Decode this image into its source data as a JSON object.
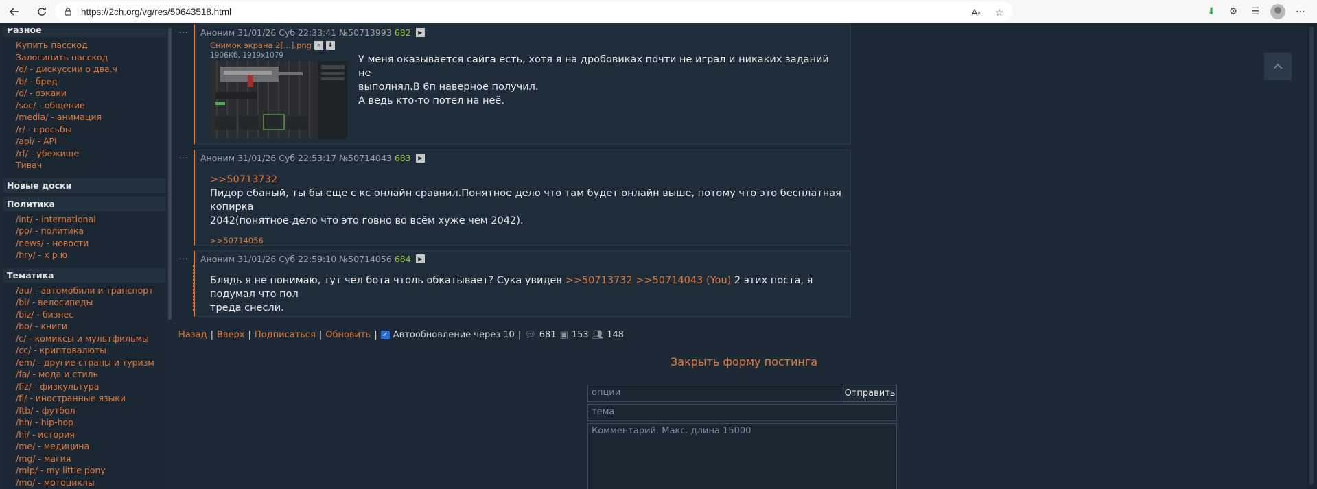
{
  "browser": {
    "url": "https://2ch.org/vg/res/50643518.html"
  },
  "sidebar": {
    "sections": [
      {
        "title": "Разное",
        "items": [
          "Купить пасскод",
          "Залогинить пасскод",
          "/d/ - дискуссии о два.ч",
          "/b/ - бред",
          "/o/ - оэкаки",
          "/soc/ - общение",
          "/media/ - анимация",
          "/r/ - просьбы",
          "/api/ - API",
          "/rf/ - убежище",
          "Тивач"
        ]
      },
      {
        "title": "Новые доски",
        "items": []
      },
      {
        "title": "Политика",
        "items": [
          "/int/ - international",
          "/po/ - политика",
          "/news/ - новости",
          "/hry/ - х р ю"
        ]
      },
      {
        "title": "Тематика",
        "items": [
          "/au/ - автомобили и транспорт",
          "/bi/ - велосипеды",
          "/biz/ - бизнес",
          "/bo/ - книги",
          "/c/ - комиксы и мультфильмы",
          "/cc/ - криптовалюты",
          "/em/ - другие страны и туризм",
          "/fa/ - мода и стиль",
          "/fiz/ - физкультура",
          "/fl/ - иностранные языки",
          "/ftb/ - футбол",
          "/hh/ - hip-hop",
          "/hi/ - история",
          "/me/ - медицина",
          "/mg/ - магия",
          "/mlp/ - my little pony",
          "/mo/ - мотоциклы"
        ]
      }
    ]
  },
  "posts": [
    {
      "author": "Аноним",
      "date": "31/01/26 Суб 22:33:41",
      "num": "№50713993",
      "ord": "682",
      "file_name": "Снимок экрана 2[...].png",
      "file_size": "1906Кб, 1919x1079",
      "lines": [
        "У меня оказывается сайга есть, хотя я на дробовиках почти не играл и никаких заданий не",
        "выполнял.В 6п наверное получил.",
        "А ведь кто-то потел на неё."
      ]
    },
    {
      "author": "Аноним",
      "date": "31/01/26 Суб 22:53:17",
      "num": "№50714043",
      "ord": "683",
      "quote": ">>50713732",
      "lines": [
        "Пидор ебаный, ты бы еще с кс онлайн сравнил.Понятное дело что там будет онлайн выше, потому что это бесплатная копирка",
        "2042(понятное дело что это говно во всём хуже чем 2042)."
      ],
      "reply": ">>50714056"
    },
    {
      "author": "Аноним",
      "date": "31/01/26 Суб 22:59:10",
      "num": "№50714056",
      "ord": "684",
      "text_a": "Блядь я не понимаю, тут чел бота чтоль обкатывает? Сука увидев",
      "link_a": ">>50713732",
      "link_b": ">>50714043",
      "you": "(You)",
      "text_b": "2 этих поста, я подумал что пол",
      "text_c": "треда снесли."
    }
  ],
  "bottom_bar": {
    "back": "Назад",
    "up": "Вверх",
    "subscribe": "Подписаться",
    "refresh": "Обновить",
    "autoupdate": "Автообновление через 10",
    "posts_count": "681",
    "files_count": "153",
    "posters_count": "148"
  },
  "form": {
    "close_label": "Закрыть форму постинга",
    "options_placeholder": "опции",
    "submit_label": "Отправить",
    "subject_placeholder": "тема",
    "comment_placeholder": "Комментарий. Макс. длина 15000"
  },
  "colors": {
    "link": "#e0793c",
    "background": "#1d2a36",
    "ordinal": "#9ac83a"
  }
}
